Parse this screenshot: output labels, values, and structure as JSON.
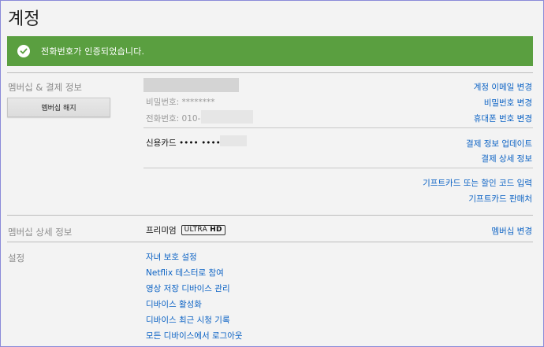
{
  "page_title": "계정",
  "banner": {
    "message": "전화번호가 인증되었습니다.",
    "icon": "check-circle-icon",
    "color": "#5a9f40"
  },
  "membership": {
    "section_label": "멤버십 & 결제 정보",
    "cancel_button": "멤버십 해지",
    "password": "비밀번호: ********",
    "phone": "전화번호: 010-",
    "card": "신용카드 •••• •••• ••••",
    "links": {
      "change_email": "계정 이메일 변경",
      "change_password": "비밀번호 변경",
      "change_phone": "휴대폰 번호 변경",
      "update_payment": "결제 정보 업데이트",
      "payment_details": "결제 상세 정보",
      "redeem_gift": "기프트카드 또는 할인 코드 입력",
      "gift_retailers": "기프트카드 판매처"
    }
  },
  "plan_details": {
    "section_label": "멤버십 상세 정보",
    "plan_name": "프리미엄",
    "badge_ultra": "ULTRA",
    "badge_hd": "HD",
    "change_plan": "멤버십 변경"
  },
  "settings": {
    "section_label": "설정",
    "links": [
      "자녀 보호 설정",
      "Netflix 테스터로 참여",
      "영상 저장 디바이스 관리",
      "디바이스 활성화",
      "디바이스 최근 시청 기록",
      "모든 디바이스에서 로그아웃"
    ]
  },
  "colors": {
    "link": "#0b62c4",
    "label": "#8c8c8c"
  }
}
